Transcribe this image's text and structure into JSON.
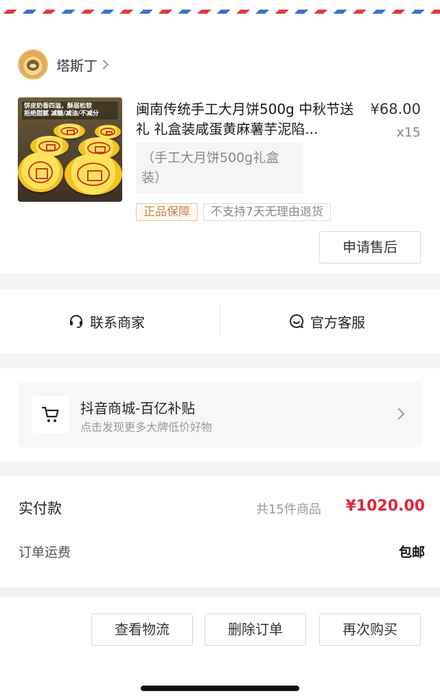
{
  "store": {
    "name": "塔斯丁"
  },
  "product": {
    "image_caption_line1": "饼皮奶香四溢，酥层松软",
    "image_caption_line2": "拒绝甜腻 减糖/减油/不减分",
    "title": "闽南传统手工大月饼500g 中秋节送礼 礼盒装咸蛋黄麻薯芋泥陷...",
    "price": "¥68.00",
    "quantity": "x15",
    "spec": "（手工大月饼500g礼盒装）",
    "tags": [
      "正品保障",
      "不支持7天无理由退货"
    ],
    "after_sale_button": "申请售后"
  },
  "contact": {
    "merchant": "联系商家",
    "official_service": "官方客服"
  },
  "promo": {
    "title": "抖音商城-百亿补贴",
    "subtitle": "点击发现更多大牌低价好物"
  },
  "payment": {
    "label": "实付款",
    "item_count": "共15件商品",
    "total": "¥1020.00",
    "shipping_label": "订单运费",
    "shipping_value": "包邮"
  },
  "actions": {
    "logistics": "查看物流",
    "delete_order": "删除订单",
    "buy_again": "再次购买"
  },
  "colors": {
    "accent_red": "#e2233e",
    "genuine_tag": "#c9834a",
    "airmail_red": "#e03a3e",
    "airmail_blue": "#3d6fcf"
  }
}
